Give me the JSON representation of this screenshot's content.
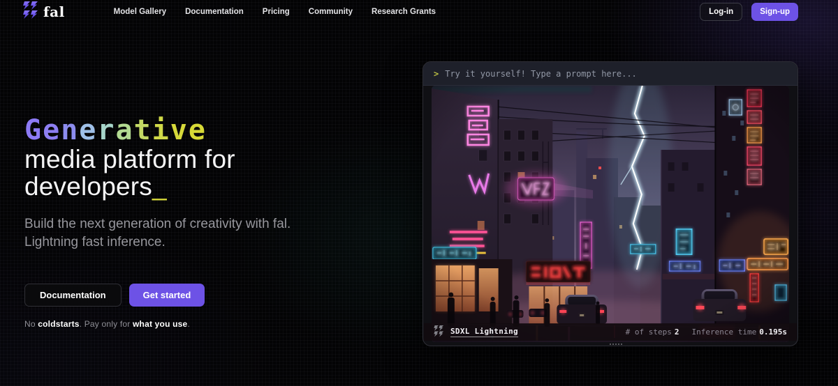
{
  "nav": {
    "logo_text": "fal",
    "items": [
      {
        "label": "Model Gallery"
      },
      {
        "label": "Documentation"
      },
      {
        "label": "Pricing"
      },
      {
        "label": "Community"
      },
      {
        "label": "Research Grants"
      }
    ],
    "login_label": "Log-in",
    "signup_label": "Sign-up"
  },
  "hero": {
    "title_word": "Generative",
    "title_letter_colors": [
      "#8D7BF6",
      "#8E7FF3",
      "#8C8CEE",
      "#9FC0E8",
      "#A6D4C9",
      "#B3DB92",
      "#C3D964",
      "#D0D948",
      "#D6D93A",
      "#D7DA36"
    ],
    "title_line2": "media platform for",
    "title_line3": "developers",
    "title_cursor": "_",
    "subtitle_line1": "Build the next generation of creativity with fal.",
    "subtitle_line2": "Lightning fast inference.",
    "documentation_button": "Documentation",
    "get_started_button": "Get started",
    "fineprint": {
      "seg_no": "No ",
      "seg_coldstarts": "coldstarts",
      "seg_mid": ". Pay only for ",
      "seg_use": "what you use",
      "seg_dot": "."
    }
  },
  "demo": {
    "prompt_prefix": ">",
    "prompt_text": "Try it yourself! Type a prompt here...",
    "model_name": "SDXL Lightning",
    "steps_label": "# of steps",
    "steps_value": "2",
    "inference_label": "Inference time",
    "inference_value": "0.195s",
    "image_alt": "AI-generated cyberpunk city street at night with pink neon signs, rain haze, cars with red taillights, and a lightning bolt striking between dark buildings"
  },
  "colors": {
    "accent_purple": "#6D52E6",
    "cursor_yellow": "#D6D93A"
  }
}
